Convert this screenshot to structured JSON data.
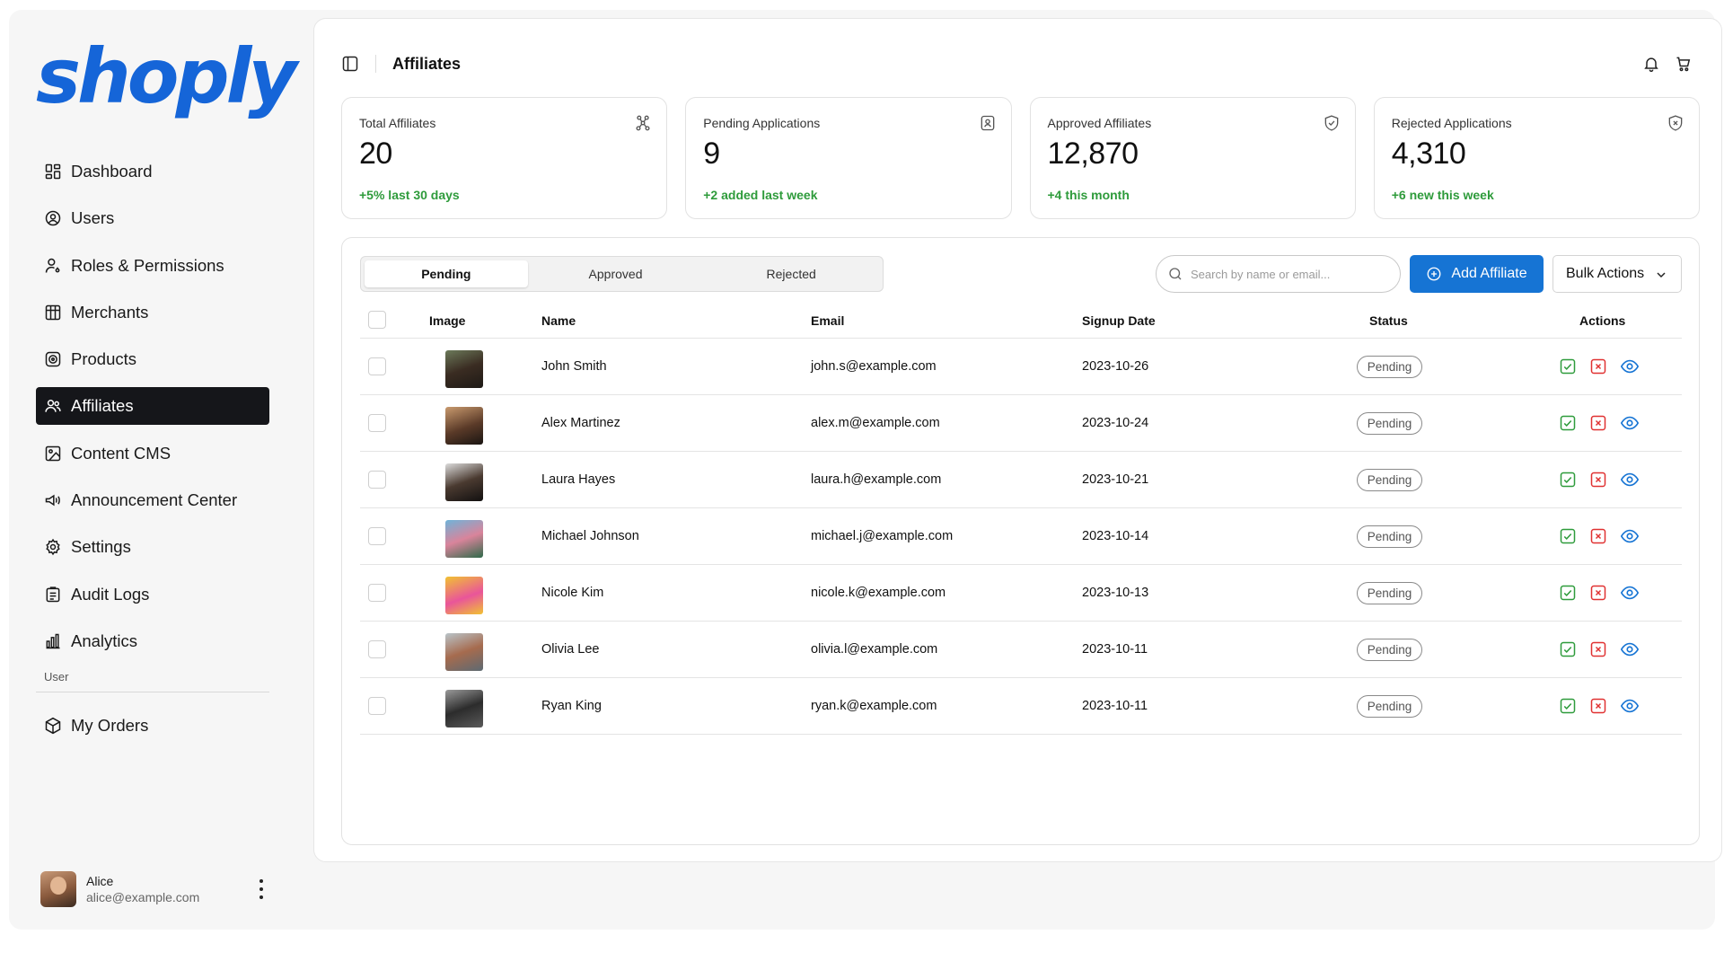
{
  "brand": {
    "logo_text": "shoply",
    "accent": "#1674d4"
  },
  "sidebar": {
    "items": [
      {
        "label": "Dashboard",
        "icon": "grid-icon"
      },
      {
        "label": "Users",
        "icon": "user-circle-icon"
      },
      {
        "label": "Roles & Permissions",
        "icon": "user-key-icon"
      },
      {
        "label": "Merchants",
        "icon": "store-icon"
      },
      {
        "label": "Products",
        "icon": "package-icon"
      },
      {
        "label": "Affiliates",
        "icon": "users-icon",
        "active": true
      },
      {
        "label": "Content CMS",
        "icon": "image-icon"
      },
      {
        "label": "Announcement Center",
        "icon": "megaphone-icon"
      },
      {
        "label": "Settings",
        "icon": "gear-icon"
      },
      {
        "label": "Audit Logs",
        "icon": "clipboard-icon"
      },
      {
        "label": "Analytics",
        "icon": "bar-chart-icon"
      }
    ],
    "section_label": "User",
    "user_items": [
      {
        "label": "My Orders",
        "icon": "box-icon"
      }
    ],
    "user": {
      "name": "Alice",
      "email": "alice@example.com"
    }
  },
  "header": {
    "title": "Affiliates"
  },
  "stats": [
    {
      "label": "Total Affiliates",
      "value": "20",
      "trend": "+5% last 30 days",
      "icon": "network-icon"
    },
    {
      "label": "Pending Applications",
      "value": "9",
      "trend": "+2 added last week",
      "icon": "badge-clock-icon"
    },
    {
      "label": "Approved Affiliates",
      "value": "12,870",
      "trend": "+4 this month",
      "icon": "shield-check-icon"
    },
    {
      "label": "Rejected Applications",
      "value": "4,310",
      "trend": "+6 new this week",
      "icon": "shield-x-icon"
    }
  ],
  "tabs": [
    "Pending",
    "Approved",
    "Rejected"
  ],
  "search": {
    "placeholder": "Search by name or email..."
  },
  "buttons": {
    "add": "Add Affiliate",
    "bulk": "Bulk Actions"
  },
  "columns": {
    "image": "Image",
    "name": "Name",
    "email": "Email",
    "signup": "Signup Date",
    "status": "Status",
    "actions": "Actions"
  },
  "rows": [
    {
      "name": "John Smith",
      "email": "john.s@example.com",
      "date": "2023-10-26",
      "status": "Pending"
    },
    {
      "name": "Alex Martinez",
      "email": "alex.m@example.com",
      "date": "2023-10-24",
      "status": "Pending"
    },
    {
      "name": "Laura Hayes",
      "email": "laura.h@example.com",
      "date": "2023-10-21",
      "status": "Pending"
    },
    {
      "name": "Michael Johnson",
      "email": "michael.j@example.com",
      "date": "2023-10-14",
      "status": "Pending"
    },
    {
      "name": "Nicole Kim",
      "email": "nicole.k@example.com",
      "date": "2023-10-13",
      "status": "Pending"
    },
    {
      "name": "Olivia Lee",
      "email": "olivia.l@example.com",
      "date": "2023-10-11",
      "status": "Pending"
    },
    {
      "name": "Ryan King",
      "email": "ryan.k@example.com",
      "date": "2023-10-11",
      "status": "Pending"
    }
  ],
  "colors": {
    "trend_green": "#2e9b3b",
    "approve_green": "#2e9b3b",
    "reject_red": "#e03131",
    "view_blue": "#1674d4"
  }
}
